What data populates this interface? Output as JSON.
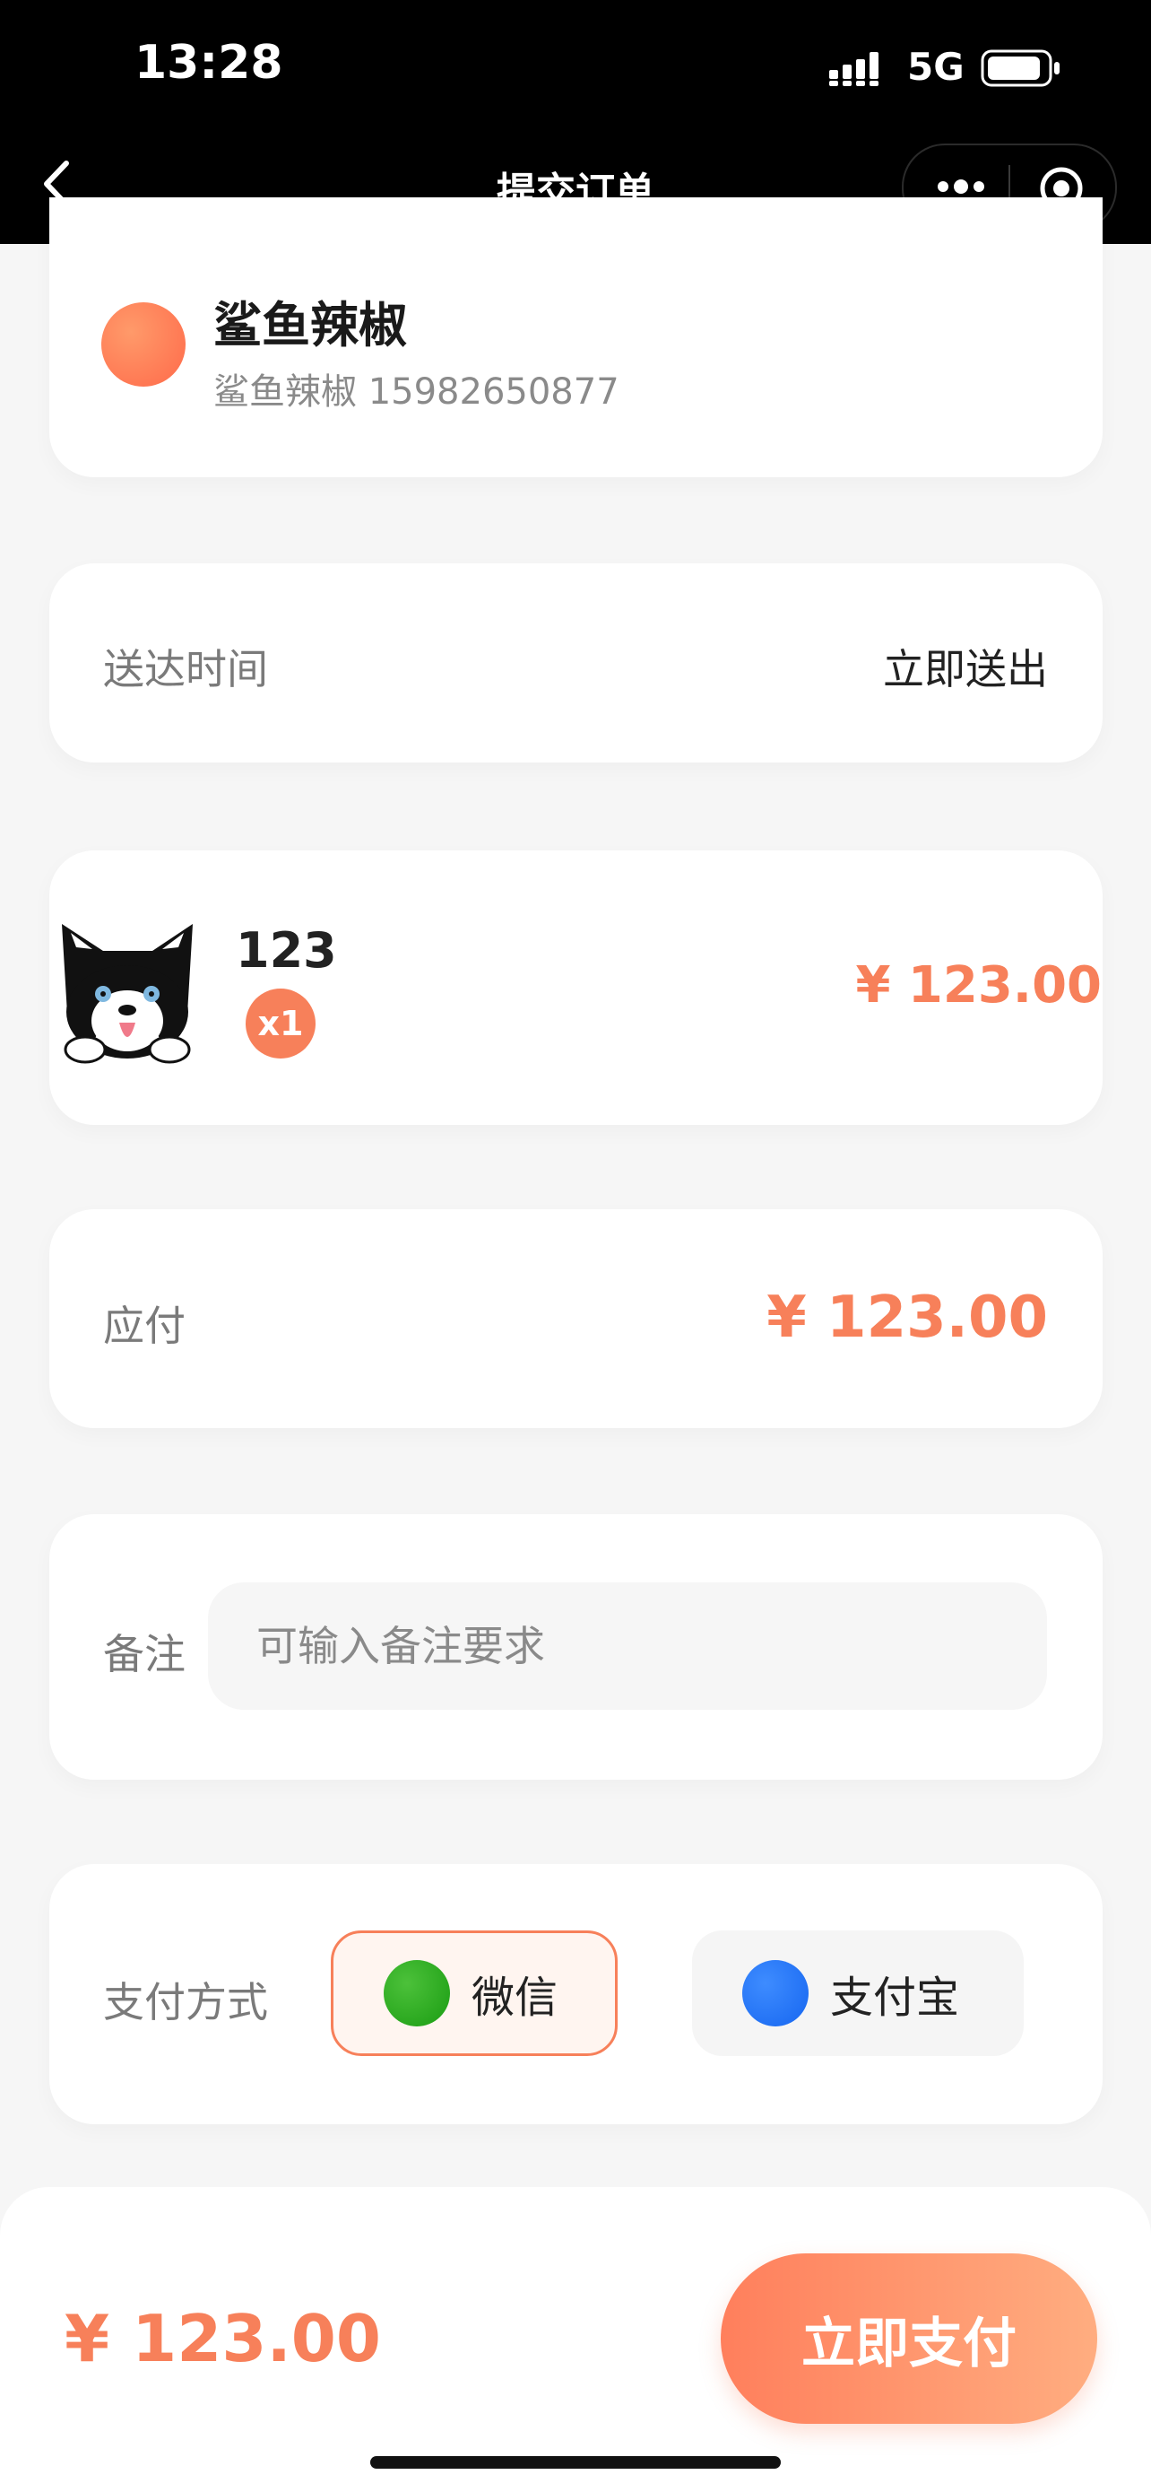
{
  "status_bar": {
    "time": "13:28",
    "network": "5G"
  },
  "nav": {
    "title": "提交订单"
  },
  "user": {
    "name": "鲨鱼辣椒",
    "contact": "鲨鱼辣椒 15982650877"
  },
  "delivery": {
    "label": "送达时间",
    "value": "立即送出"
  },
  "goods": {
    "name": "123",
    "quantity": "x1",
    "price": "¥ 123.00"
  },
  "amount_due": {
    "label": "应付",
    "value": "¥ 123.00"
  },
  "remark": {
    "label": "备注",
    "placeholder": "可输入备注要求",
    "value": ""
  },
  "payment": {
    "label": "支付方式",
    "options": [
      {
        "label": "微信",
        "selected": true,
        "color": "#1a9c12"
      },
      {
        "label": "支付宝",
        "selected": false,
        "color": "#1666f0"
      }
    ]
  },
  "footer": {
    "total": "¥ 123.00",
    "pay_button": "立即支付"
  },
  "colors": {
    "accent": "#f7805a",
    "background": "#f6f6f6"
  }
}
